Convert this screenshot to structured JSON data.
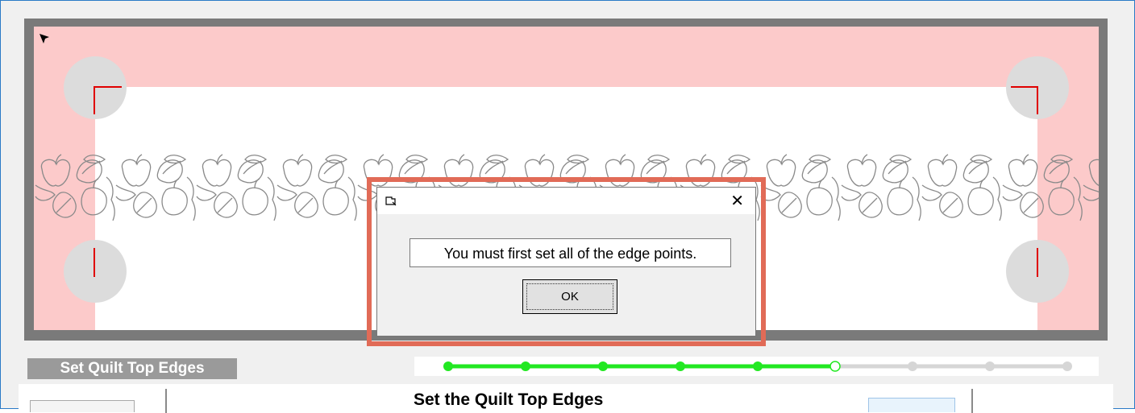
{
  "section": {
    "label": "Set Quilt Top Edges"
  },
  "panel": {
    "title": "Set the Quilt Top Edges"
  },
  "wizard": {
    "total_steps": 9,
    "current_step": 6,
    "completed_steps": 5
  },
  "colors": {
    "accent_green": "#22e822",
    "margin_pink": "#fccaca",
    "edge_marker_red": "#e00000",
    "dialog_highlight": "#e16b57"
  },
  "dialog": {
    "title": "",
    "message": "You must first set all of the edge points.",
    "ok_label": "OK",
    "close_icon": "close-icon"
  }
}
